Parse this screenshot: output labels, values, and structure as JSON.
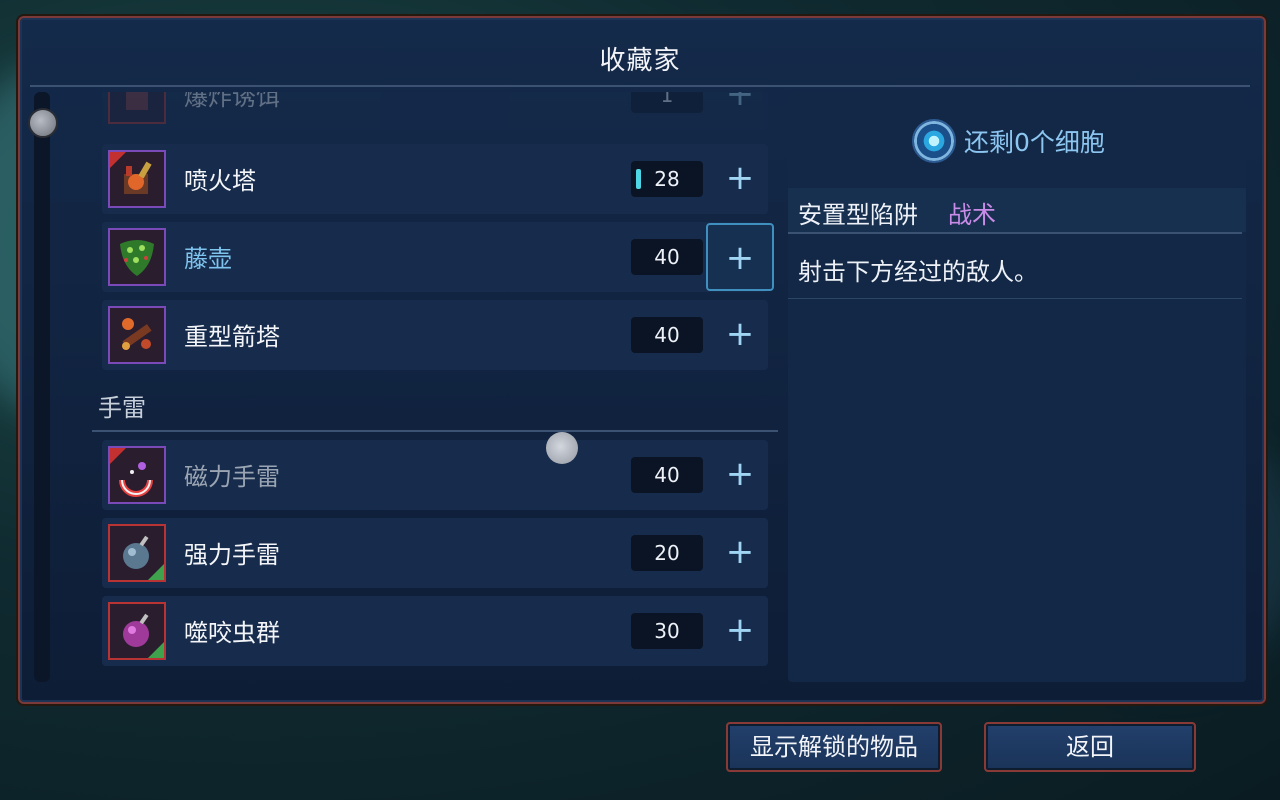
{
  "screen": {
    "title": "收藏家"
  },
  "list": {
    "rows": [
      {
        "name": "爆炸诱饵",
        "cost": "1",
        "plus": "+",
        "icon": "explosive-decoy-icon"
      },
      {
        "name": "喷火塔",
        "cost": "28",
        "plus": "+",
        "icon": "flamethrower-turret-icon",
        "progress": "partial"
      },
      {
        "name": "藤壶",
        "cost": "40",
        "plus": "+",
        "icon": "barnacle-icon",
        "focused": true
      },
      {
        "name": "重型箭塔",
        "cost": "40",
        "plus": "+",
        "icon": "heavy-crossbow-icon"
      }
    ],
    "category": "手雷",
    "grenades": [
      {
        "name": "磁力手雷",
        "cost": "40",
        "plus": "+",
        "icon": "magnetic-grenade-icon"
      },
      {
        "name": "强力手雷",
        "cost": "20",
        "plus": "+",
        "icon": "powerful-grenade-icon"
      },
      {
        "name": "噬咬虫群",
        "cost": "30",
        "plus": "+",
        "icon": "swarm-icon"
      }
    ]
  },
  "detail": {
    "cells_remaining": "还剩0个细胞",
    "type": "安置型陷阱",
    "tactic": "战术",
    "description": "射击下方经过的敌人。"
  },
  "buttons": {
    "show_unlocked": "显示解锁的物品",
    "back": "返回"
  },
  "colors": {
    "accent_cyan": "#7fc4ee",
    "tactic_purple": "#c98be8",
    "frame_red": "#8a3a36"
  }
}
